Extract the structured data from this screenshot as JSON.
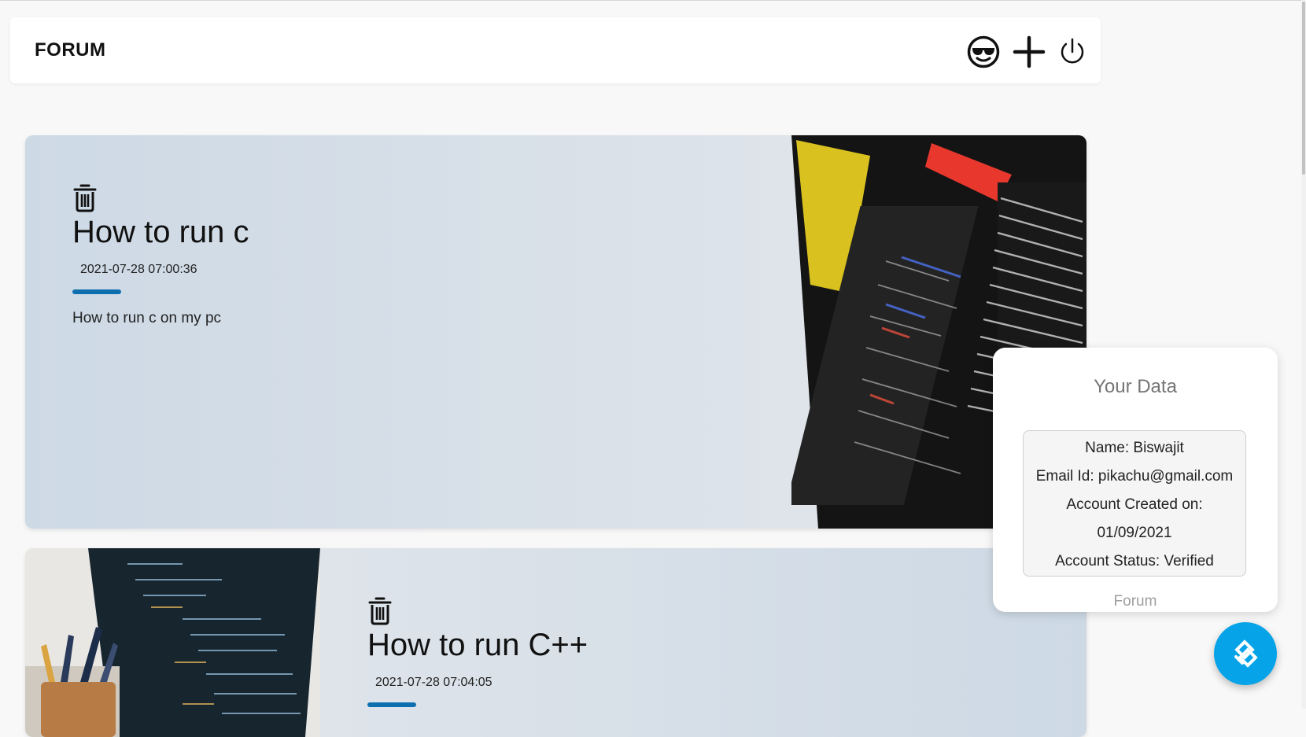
{
  "navbar": {
    "brand": "FORUM",
    "icons": [
      "sunglasses-face-icon",
      "plus-icon",
      "power-icon"
    ]
  },
  "posts": [
    {
      "title": "How to run c",
      "date": "2021-07-28 07:00:36",
      "description": "How to run c on my pc"
    },
    {
      "title": "How to run C++",
      "date": "2021-07-28 07:04:05",
      "description": ""
    }
  ],
  "popup": {
    "title": "Your Data",
    "lines": [
      "Name: Biswajit",
      "Email Id: pikachu@gmail.com",
      "Account Created on:",
      "01/09/2021",
      "Account Status: Verified"
    ],
    "footer": "Forum"
  },
  "fab": {
    "icon": "blocks-logo-icon"
  },
  "colors": {
    "accent": "#0d6fb0",
    "fab": "#06a3e8",
    "card_gradient_start": "#cdd9e5",
    "card_gradient_end": "#e5e8ec"
  }
}
